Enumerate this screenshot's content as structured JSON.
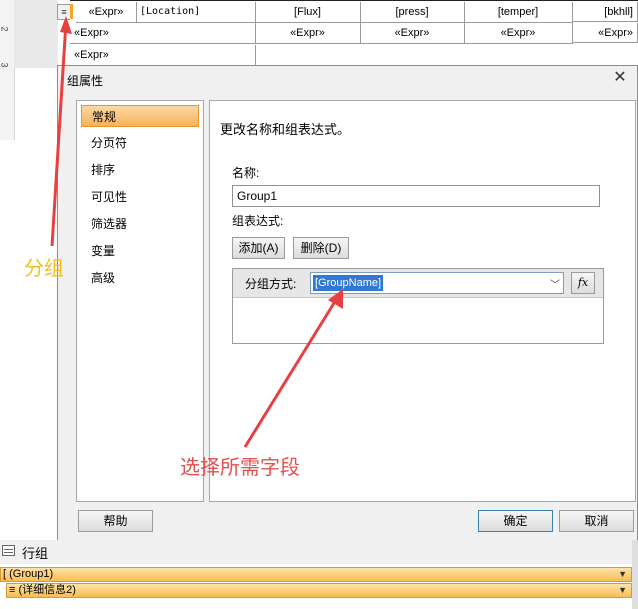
{
  "ruler": {
    "marks": [
      "2",
      "3"
    ]
  },
  "designer": {
    "row_handle_icon": "group-handle-icon",
    "header_row": [
      "«Expr»",
      "[Location]",
      "[Flux]",
      "[press]",
      "[temper]",
      "[bkhll]"
    ],
    "row2_first": "«Expr»",
    "row2_cells": [
      "«Expr»",
      "«Expr»",
      "«Expr»",
      "«Expr»"
    ],
    "row3_first": "«Expr»"
  },
  "dialog": {
    "title": "组属性",
    "nav_items": [
      "常规",
      "分页符",
      "排序",
      "可见性",
      "筛选器",
      "变量",
      "高级"
    ],
    "active_nav": "常规",
    "heading": "更改名称和组表达式。",
    "name_label": "名称:",
    "name_value": "Group1",
    "expr_label": "组表达式:",
    "add_button": "添加(A)",
    "delete_button": "删除(D)",
    "group_by_label": "分组方式:",
    "group_by_value": "[GroupName]",
    "fx_label": "fx",
    "help_button": "帮助",
    "ok_button": "确定",
    "cancel_button": "取消"
  },
  "row_groups": {
    "title": "行组",
    "items": [
      "(Group1)",
      "(详细信息2)"
    ]
  },
  "annotations": {
    "group_note": "分组",
    "select_note": "选择所需字段",
    "group_color": "#f0c020",
    "select_color": "#e05050"
  },
  "colors": {
    "nav_active": "#f7b256",
    "selection": "#3078d4",
    "row_group_fill": "#f7bd52"
  }
}
